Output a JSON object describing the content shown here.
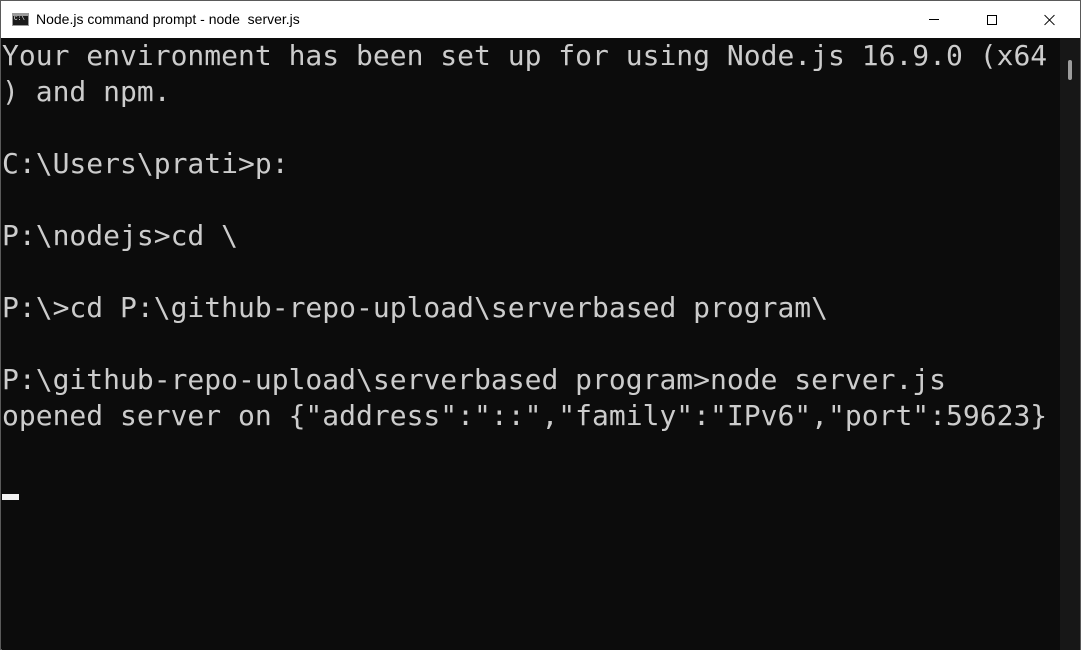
{
  "window": {
    "title": "Node.js command prompt - node  server.js",
    "app_icon_text": "C:\\",
    "controls": {
      "minimize": "minimize",
      "maximize": "maximize",
      "close": "close"
    }
  },
  "console": {
    "lines": [
      "Your environment has been set up for using Node.js 16.9.0 (x64",
      ") and npm.",
      "",
      "C:\\Users\\prati>p:",
      "",
      "P:\\nodejs>cd \\",
      "",
      "P:\\>cd P:\\github-repo-upload\\serverbased program\\",
      "",
      "P:\\github-repo-upload\\serverbased program>node server.js",
      "opened server on {\"address\":\"::\",\"family\":\"IPv6\",\"port\":59623}",
      ""
    ]
  },
  "colors": {
    "background": "#0c0c0c",
    "text": "#cccccc",
    "titlebar": "#ffffff"
  },
  "icons": {
    "app": "console-app-icon",
    "minimize": "minimize-icon",
    "maximize": "maximize-icon",
    "close": "close-icon"
  }
}
